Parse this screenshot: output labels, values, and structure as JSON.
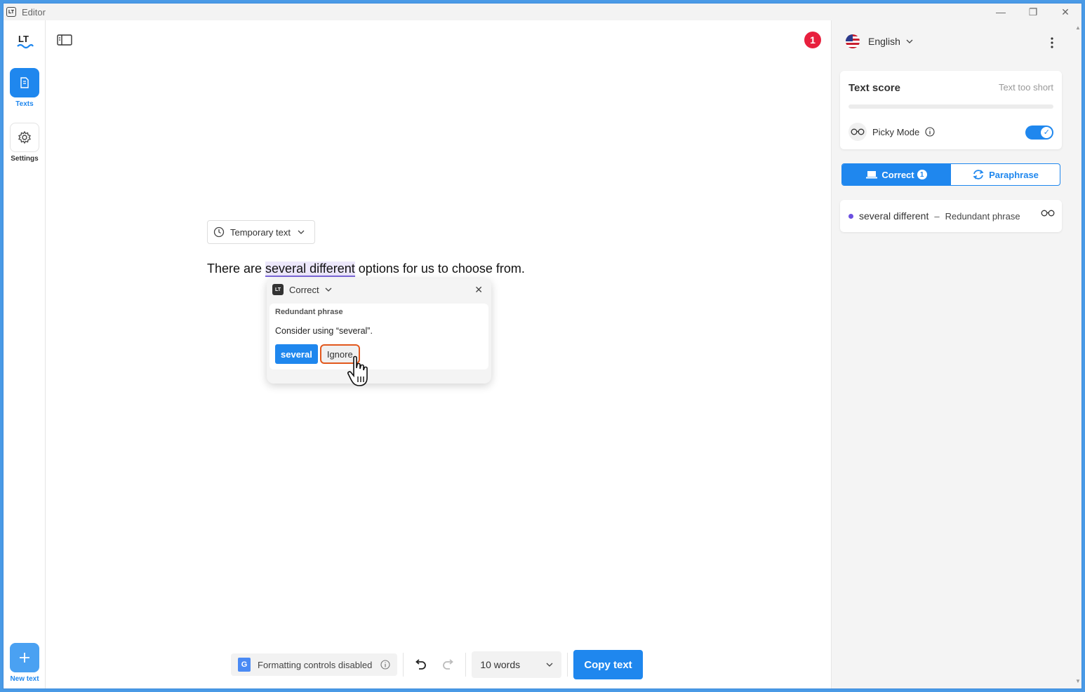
{
  "window": {
    "title": "Editor",
    "minimize": "—",
    "maximize": "❐",
    "close": "✕"
  },
  "rail": {
    "logo": "LT",
    "items": [
      {
        "label": "Texts",
        "icon": "document-icon"
      },
      {
        "label": "Settings",
        "icon": "gear-icon"
      }
    ],
    "new_text": {
      "label": "New text",
      "icon": "plus-icon"
    }
  },
  "editor": {
    "error_count": "1",
    "temp_dropdown": "Temporary text",
    "text_before": "There are ",
    "text_highlight": "several different",
    "text_after": " options for us to choose from.",
    "popup": {
      "mode": "Correct",
      "category": "Redundant phrase",
      "message": "Consider using “several”.",
      "suggestion": "several",
      "ignore": "Ignore"
    },
    "toolbar": {
      "formatting": "Formatting controls disabled",
      "words": "10 words",
      "copy": "Copy text"
    }
  },
  "panel": {
    "language": "English",
    "score": {
      "title": "Text score",
      "status": "Text too short",
      "picky_label": "Picky Mode",
      "picky_on": true
    },
    "tabs": {
      "correct": "Correct",
      "correct_count": "1",
      "paraphrase": "Paraphrase"
    },
    "issue": {
      "phrase": "several different",
      "dash": "–",
      "category": "Redundant phrase"
    }
  },
  "colors": {
    "accent": "#1f87ee",
    "error": "#e8203e",
    "highlight_underline": "#7b68d9",
    "ignore_outline": "#e2581d"
  }
}
